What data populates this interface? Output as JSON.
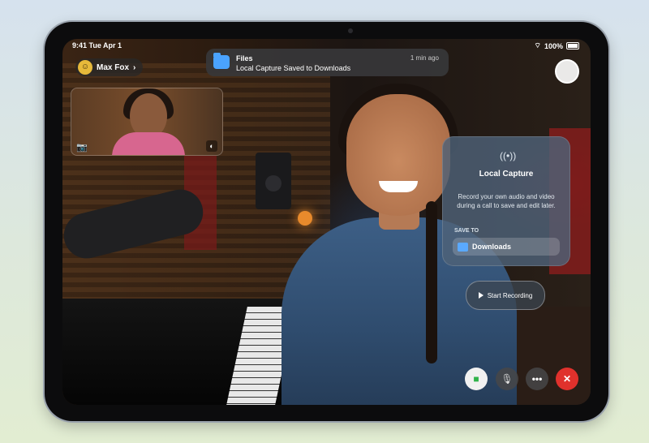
{
  "status_bar": {
    "time_date": "9:41 Tue Apr 1",
    "battery": "100%"
  },
  "caller": {
    "name": "Max Fox",
    "chevron": "›"
  },
  "notification": {
    "app": "Files",
    "message": "Local Capture Saved to Downloads",
    "time": "1 min ago",
    "icon": "files-folder-icon"
  },
  "local_capture": {
    "title": "Local Capture",
    "description": "Record your own audio and video during a call to save and edit later.",
    "save_to_label": "SAVE TO",
    "destination": "Downloads"
  },
  "start_recording": {
    "label": "Start Recording"
  },
  "controls": {
    "video_icon": "video-camera-icon",
    "mute_icon": "microphone-icon",
    "more_label": "•••",
    "end_label": "✕"
  },
  "colors": {
    "end_call": "#e0312c",
    "video_active": "#2fb34a",
    "folder": "#5aa9ff"
  }
}
